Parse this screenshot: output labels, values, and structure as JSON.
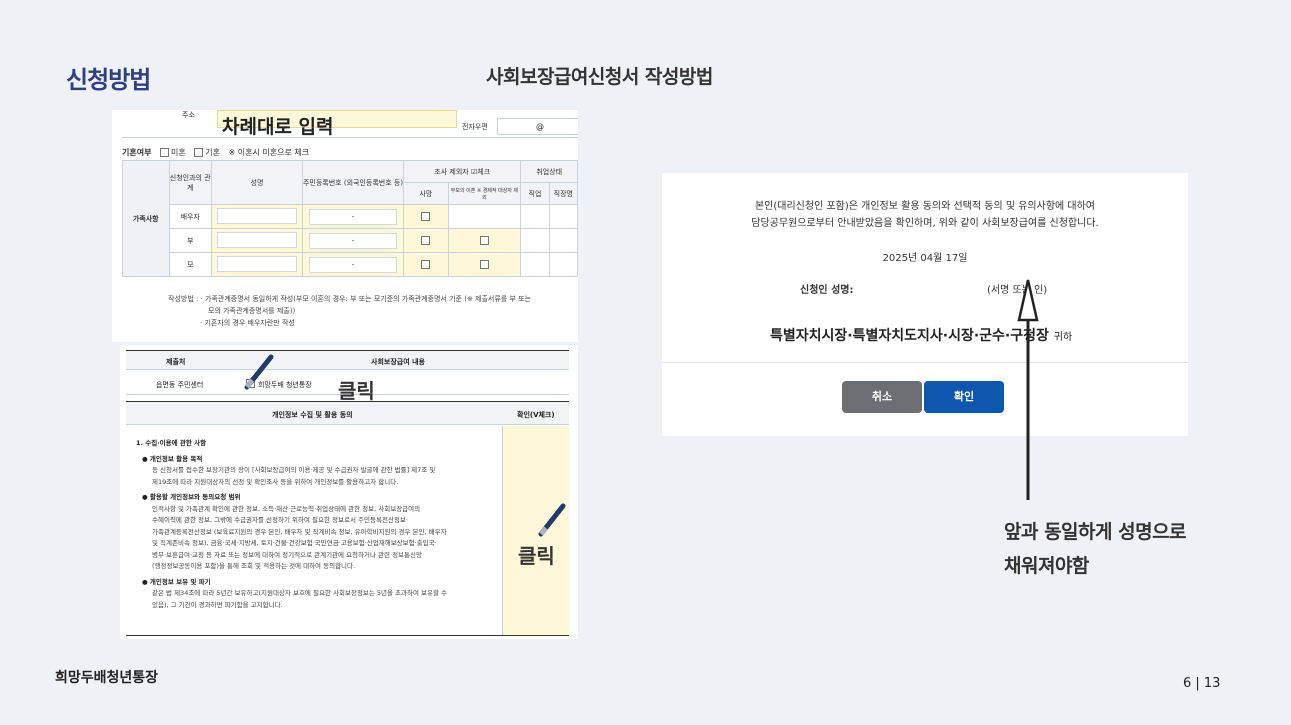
{
  "header": {
    "section_title": "신청방법",
    "page_title": "사회보장급여신청서 작성방법"
  },
  "form_family": {
    "address_label": "주소",
    "address_instruction": "차례대로 입력",
    "email_label": "전자우편",
    "email_value": "@",
    "marital_label": "기혼여부",
    "unmarried": "미혼",
    "married": "기혼",
    "marital_note": "※ 이혼시 미혼으로 체크",
    "group_label": "가족사항",
    "columns": {
      "relation": "신청인과의 관계",
      "name": "성명",
      "rrn": "주민등록번호 (외국인등록번호 등)",
      "exclude": "조사 제외자 ☑체크",
      "exclude_death": "사망",
      "exclude_divorce": "부모의 이혼 ※ 경제적 대상자 제외",
      "employment": "취업상태",
      "emp_job": "직업",
      "emp_work": "직장명"
    },
    "rows": [
      {
        "relation": "배우자",
        "rrn": "-"
      },
      {
        "relation": "부",
        "rrn": "-"
      },
      {
        "relation": "모",
        "rrn": "-"
      }
    ],
    "note_label": "작성방법 :",
    "note_line1": "· 가족관계증명서 동일하게 작성(부모 이혼의 경우: 부 또는 모기준의 가족관계증명서 기준 (※ 제출서류를 부 또는",
    "note_line2": "모의 가족관계증명서를 제출))",
    "note_line3": "· 기혼자의 경우 배우자란만 작성"
  },
  "form_submit": {
    "col_recipient": "제출처",
    "col_content": "사회보장급여 내용",
    "recipient": "읍면동 주민센터",
    "content": "희망두배 청년통장",
    "click_label_1": "클릭",
    "consent_title": "개인정보 수집 및 활용 동의",
    "consent_check_col": "확인(V체크)",
    "section1": "1. 수집·이용에 관한 사항",
    "purpose_title": "● 개인정보 활용 목적",
    "purpose_1": "동 신청서를 접수한 보장기관의 장이 [사회보장급여의 이용·제공 및 수급권자 발굴에 관한 법률] 제7조 및",
    "purpose_2": "제19조에 따라 지원대상자의 선정 및 확인조사 등을 위하여 개인정보를 활용하고자 합니다.",
    "scope_title": "● 활용할 개인정보와 동의요청 범위",
    "scope_1": "인적사항 및 가족관계 확인에 관한 정보, 소득·재산·근로능력·취업상태에 관한 정보, 사회보장급여의",
    "scope_2": "수혜이력에 관한 정보, 그밖에 수급권자를 선정하기 위하여 필요한 정보로서 주민등록전산정보·",
    "scope_3": "가족관계등록전산정보 (보육료지원의 경우 본인, 배우자 및 직계비속 정보, 유아학비지원의 경우 본인, 배우자",
    "scope_4": "및 직계존비속 정보), 금융·국세·지방세, 토지·건물·건강보험·국민연금·고용보험·산업재해보상보험·출입국·",
    "scope_5": "병무·보훈급여·교정 등 자료 또는 정보에 대하여 정기적으로 관계기관에 요청하거나 관련 정보통신망",
    "scope_6": "(행정정보공동이용 포함)을 통해 조회 및 적용하는 것에 대하여 동의합니다.",
    "retention_title": "● 개인정보 보유 및 파기",
    "retention_1": "같은 법 제34조에 따라 5년간 보유하고(지원대상자 보호에 필요한 사회보장정보는 5년을 초과하여 보유할 수",
    "retention_2": "있음), 그 기간이 경과하면 파기함을 고지합니다.",
    "click_label_2": "클릭"
  },
  "dialog": {
    "line1": "본인(대리신청인 포함)은 개인정보 활용 동의와 선택적 동의 및 유의사항에 대하여",
    "line2": "담당공무원으로부터 안내받았음을 확인하며, 위와 같이 사회보장급여를 신청합니다.",
    "date": "2025년 04월 17일",
    "applicant_label": "신청인 성명:",
    "signature_hint": "(서명 또는 인)",
    "authority": "특별자치시장·특별자치도지사·시장·군수·구청장",
    "authority_suffix": "귀하",
    "cancel_label": "취소",
    "confirm_label": "확인"
  },
  "callout": {
    "line1": "앞과 동일하게 성명으로",
    "line2": "채워져야함"
  },
  "footer": {
    "brand": "희망두배청년통장",
    "page": "6 | 13"
  },
  "colors": {
    "title_blue": "#2f3f86",
    "highlight_yellow": "#fff8d8",
    "confirm_blue": "#0d57b0",
    "cancel_gray": "#6b6e72"
  }
}
